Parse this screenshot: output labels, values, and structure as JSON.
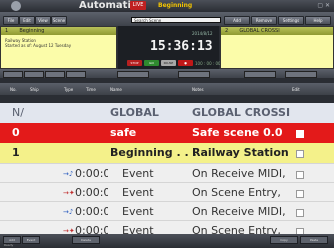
{
  "app": {
    "title": "Automation",
    "live_label": "LIVE",
    "scene_title": "Beginning"
  },
  "toolbar": {
    "buttons": [
      "File",
      "Edit",
      "View",
      "Scene",
      "Add",
      "Remove",
      "Settings",
      "Help"
    ],
    "search_placeholder": "Search Scene"
  },
  "panel_left": {
    "number": "1",
    "heading": "Beginning",
    "line1": "Railway Station",
    "line2": "Started as of: August 12 Tuesday"
  },
  "panel_right": {
    "number": "2",
    "heading": "GLOBAL CROSSI"
  },
  "clock": {
    "time": "15:36:13",
    "date": "2014/8/12",
    "sub": "100 : 00 : 00",
    "stop": "STOP",
    "go": "GO",
    "pause": "PAUSE"
  },
  "table": {
    "headers": [
      "No.",
      "Ship",
      "Type",
      "Time",
      "Name",
      "Notes",
      "Edit"
    ],
    "global_row": {
      "no": "N/",
      "name": "GLOBAL",
      "notes": "GLOBAL CROSSI"
    },
    "safe_row": {
      "no": "0",
      "name": "safe",
      "notes": "Safe scene 0.0"
    },
    "begin_row": {
      "no": "1",
      "name": "Beginning . . .",
      "notes": "Railway Station"
    },
    "event_rows": [
      {
        "time": "0:00:0(",
        "name": "Event",
        "notes": "On Receive MIDI,"
      },
      {
        "time": "0:00:0(",
        "name": "Event",
        "notes": "On Scene Entry,"
      },
      {
        "time": "0:00:0(",
        "name": "Event",
        "notes": "On Receive MIDI,"
      },
      {
        "time": "0:00:0(",
        "name": "Event",
        "notes": "On Scene Entry,"
      }
    ]
  },
  "bottom": {
    "status": "Ready",
    "buttons": [
      "Add",
      "Event",
      "Delete",
      "Copy",
      "Paste"
    ]
  }
}
